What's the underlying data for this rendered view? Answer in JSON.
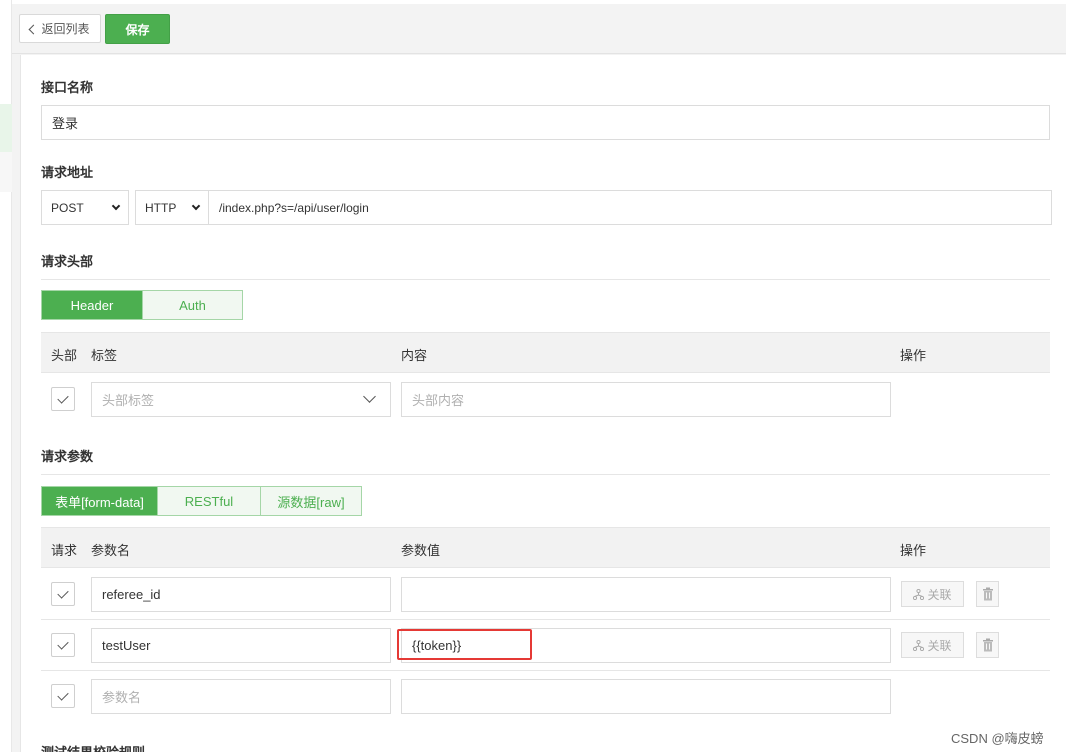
{
  "toolbar": {
    "back_label": "返回列表",
    "save_label": "保存"
  },
  "interface_name": {
    "title": "接口名称",
    "value": "登录"
  },
  "request_url": {
    "title": "请求地址",
    "method": "POST",
    "protocol": "HTTP",
    "path": "/index.php?s=/api/user/login"
  },
  "request_headers": {
    "title": "请求头部",
    "tabs": [
      {
        "label": "Header",
        "active": true
      },
      {
        "label": "Auth",
        "active": false
      }
    ],
    "columns": {
      "enabled": "头部",
      "label": "标签",
      "content": "内容",
      "actions": "操作"
    },
    "rows": [
      {
        "checked": true,
        "label_placeholder": "头部标签",
        "content_placeholder": "头部内容"
      }
    ]
  },
  "request_params": {
    "title": "请求参数",
    "tabs": [
      {
        "label": "表单[form-data]",
        "active": true
      },
      {
        "label": "RESTful",
        "active": false
      },
      {
        "label": "源数据[raw]",
        "active": false
      }
    ],
    "columns": {
      "enabled": "请求",
      "name": "参数名",
      "value": "参数值",
      "actions": "操作"
    },
    "link_label": "关联",
    "rows": [
      {
        "checked": true,
        "name": "referee_id",
        "value": ""
      },
      {
        "checked": true,
        "name": "testUser",
        "value": "{{token}}"
      },
      {
        "checked": true,
        "name_placeholder": "参数名",
        "value": ""
      }
    ]
  },
  "next_section_title": "测试结果校验规则",
  "watermark": "CSDN @嗨皮螃",
  "colors": {
    "accent": "#4caf50",
    "highlight": "#e53935"
  },
  "icons": [
    "chevron-left-icon",
    "chevron-down-icon",
    "check-icon",
    "link-icon",
    "trash-icon"
  ]
}
